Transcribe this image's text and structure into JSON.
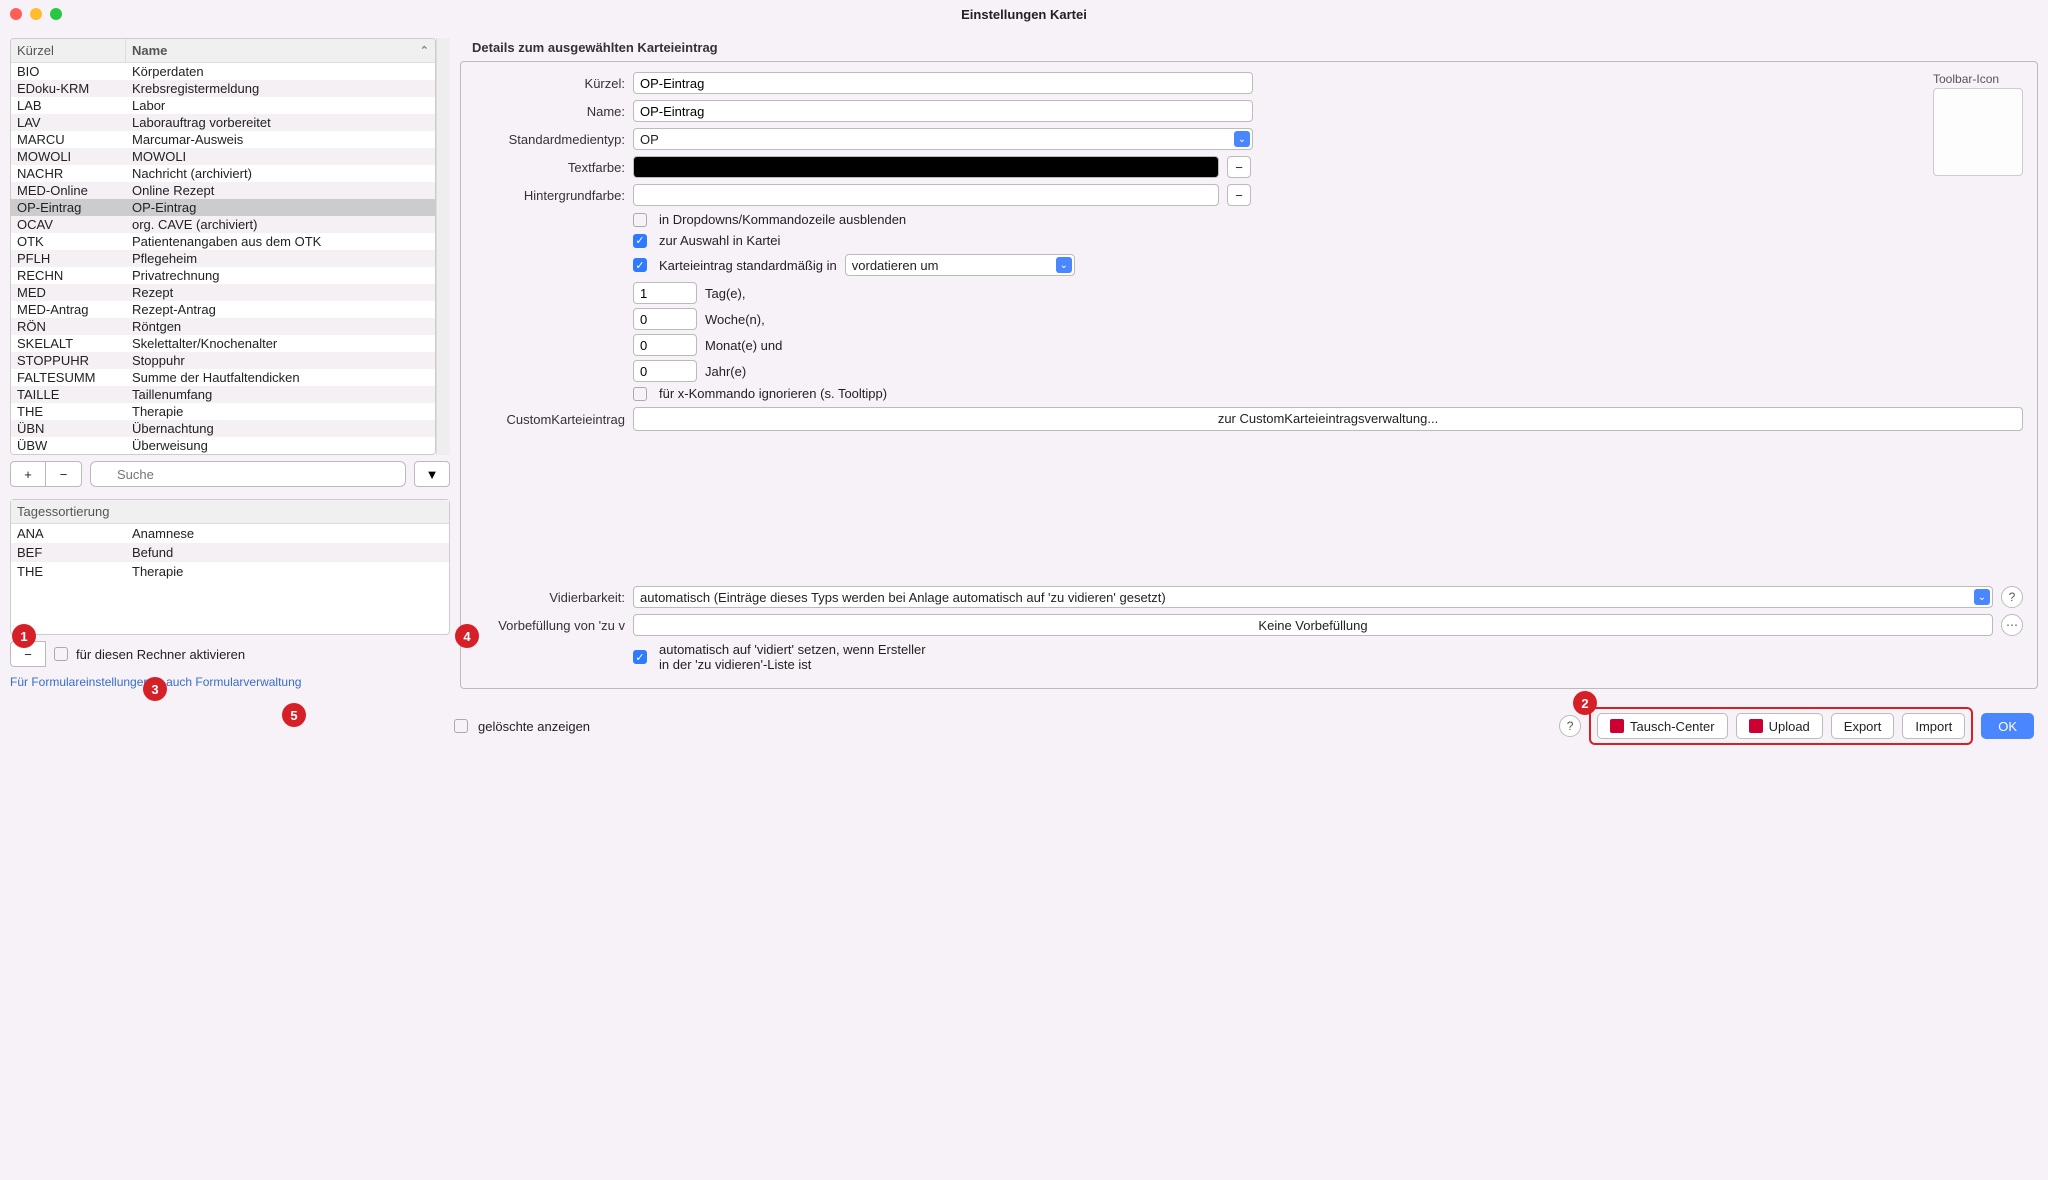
{
  "title": "Einstellungen Kartei",
  "columns": {
    "kurzel": "Kürzel",
    "name": "Name"
  },
  "entries": [
    {
      "k": "BIO",
      "n": "Körperdaten"
    },
    {
      "k": "EDoku-KRM",
      "n": "Krebsregistermeldung"
    },
    {
      "k": "LAB",
      "n": "Labor"
    },
    {
      "k": "LAV",
      "n": "Laborauftrag vorbereitet"
    },
    {
      "k": "MARCU",
      "n": "Marcumar-Ausweis"
    },
    {
      "k": "MOWOLI",
      "n": "MOWOLI"
    },
    {
      "k": "NACHR",
      "n": "Nachricht (archiviert)"
    },
    {
      "k": "MED-Online",
      "n": "Online Rezept"
    },
    {
      "k": "OP-Eintrag",
      "n": "OP-Eintrag",
      "selected": true
    },
    {
      "k": "OCAV",
      "n": "org. CAVE (archiviert)"
    },
    {
      "k": "OTK",
      "n": "Patientenangaben aus dem OTK"
    },
    {
      "k": "PFLH",
      "n": "Pflegeheim"
    },
    {
      "k": "RECHN",
      "n": "Privatrechnung"
    },
    {
      "k": "MED",
      "n": "Rezept"
    },
    {
      "k": "MED-Antrag",
      "n": "Rezept-Antrag"
    },
    {
      "k": "RÖN",
      "n": "Röntgen"
    },
    {
      "k": "SKELALT",
      "n": "Skelettalter/Knochenalter"
    },
    {
      "k": "STOPPUHR",
      "n": "Stoppuhr"
    },
    {
      "k": "FALTESUMM",
      "n": "Summe der Hautfaltendicken"
    },
    {
      "k": "TAILLE",
      "n": "Taillenumfang"
    },
    {
      "k": "THE",
      "n": "Therapie"
    },
    {
      "k": "ÜBN",
      "n": "Übernachtung"
    },
    {
      "k": "ÜBW",
      "n": "Überweisung"
    }
  ],
  "search_placeholder": "Suche",
  "sort_header": "Tagessortierung",
  "sort_items": [
    {
      "k": "ANA",
      "n": "Anamnese"
    },
    {
      "k": "BEF",
      "n": "Befund"
    },
    {
      "k": "THE",
      "n": "Therapie"
    }
  ],
  "activate_label": "für diesen Rechner aktivieren",
  "form_link": "Für Formulareinstellungen s. auch Formularverwaltung",
  "details_header": "Details zum ausgewählten Karteieintrag",
  "labels": {
    "kurzel": "Kürzel:",
    "name": "Name:",
    "mediatype": "Standardmedientyp:",
    "textcolor": "Textfarbe:",
    "bgcolor": "Hintergrundfarbe:",
    "hide_dropdown": "in Dropdowns/Kommandozeile ausblenden",
    "auswahl": "zur Auswahl in Kartei",
    "standard_in": "Karteieintrag standardmäßig in",
    "vordatieren": "vordatieren um",
    "tage": "Tag(e),",
    "wochen": "Woche(n),",
    "monate": "Monat(e) und",
    "jahre": "Jahr(e)",
    "xignore": "für x-Kommando ignorieren (s. Tooltipp)",
    "custom_label": "CustomKarteieintrag",
    "custom_btn": "zur CustomKarteieintragsverwaltung...",
    "toolbar_icon": "Toolbar-Icon",
    "vidierbarkeit": "Vidierbarkeit:",
    "vidier_value": "automatisch (Einträge dieses Typs werden bei Anlage automatisch auf 'zu vidieren' gesetzt)",
    "vorbefullung": "Vorbefüllung von 'zu v",
    "vorbef_value": "Keine Vorbefüllung",
    "auto_vidiert": "automatisch auf 'vidiert' setzen, wenn Ersteller",
    "auto_vidiert2": "in der 'zu vidieren'-Liste ist"
  },
  "values": {
    "kurzel": "OP-Eintrag",
    "name": "OP-Eintrag",
    "mediatype": "OP",
    "tag": "1",
    "woche": "0",
    "monat": "0",
    "jahr": "0"
  },
  "footer": {
    "deleted": "gelöschte anzeigen",
    "tausch": "Tausch-Center",
    "upload": "Upload",
    "export": "Export",
    "import": "Import",
    "ok": "OK"
  },
  "badges": {
    "b1": "1",
    "b2": "2",
    "b3": "3",
    "b4": "4",
    "b5": "5"
  }
}
